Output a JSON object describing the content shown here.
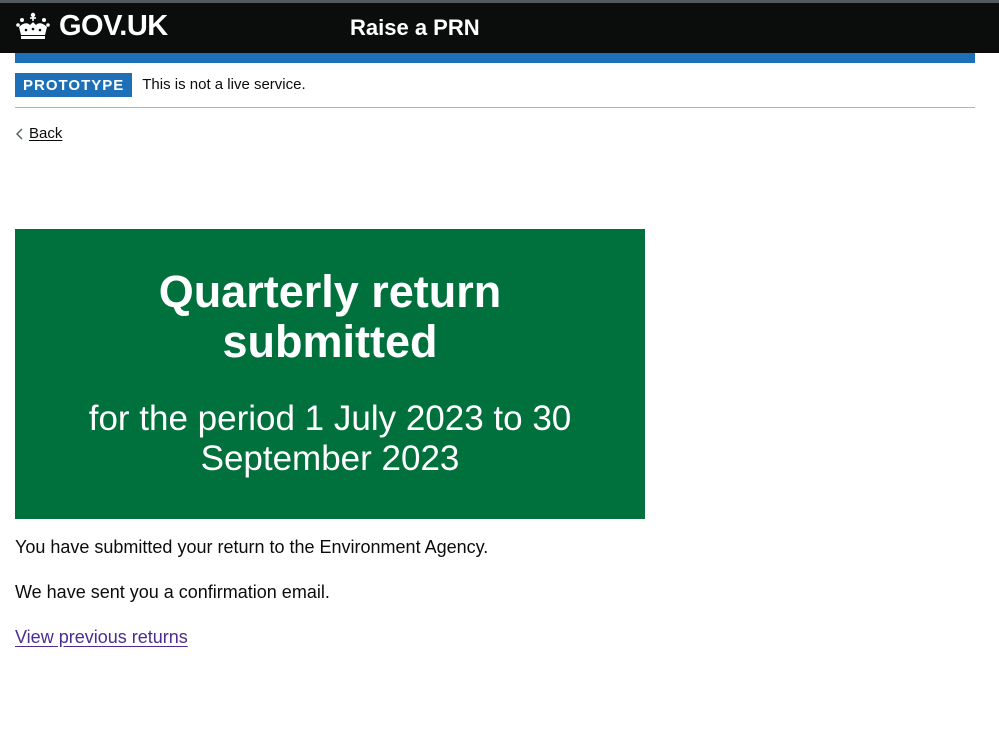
{
  "header": {
    "logo_text": "GOV.UK",
    "service_name": "Raise a PRN"
  },
  "phase_banner": {
    "tag": "PROTOTYPE",
    "text": "This is not a live service."
  },
  "back_link": {
    "label": "Back"
  },
  "panel": {
    "title": "Quarterly return submitted",
    "body": "for the period 1 July 2023 to 30 September 2023"
  },
  "content": {
    "paragraph_1": "You have submitted your return to the Environment Agency.",
    "paragraph_2": "We have sent you a confirmation email.",
    "link_label": "View previous returns"
  },
  "colors": {
    "header_bg": "#0b0c0c",
    "brand_blue": "#1d70b8",
    "panel_green": "#00703c",
    "visited_link": "#4c2c92"
  },
  "icons": {
    "logo": "crown-icon",
    "back": "chevron-left-icon"
  }
}
